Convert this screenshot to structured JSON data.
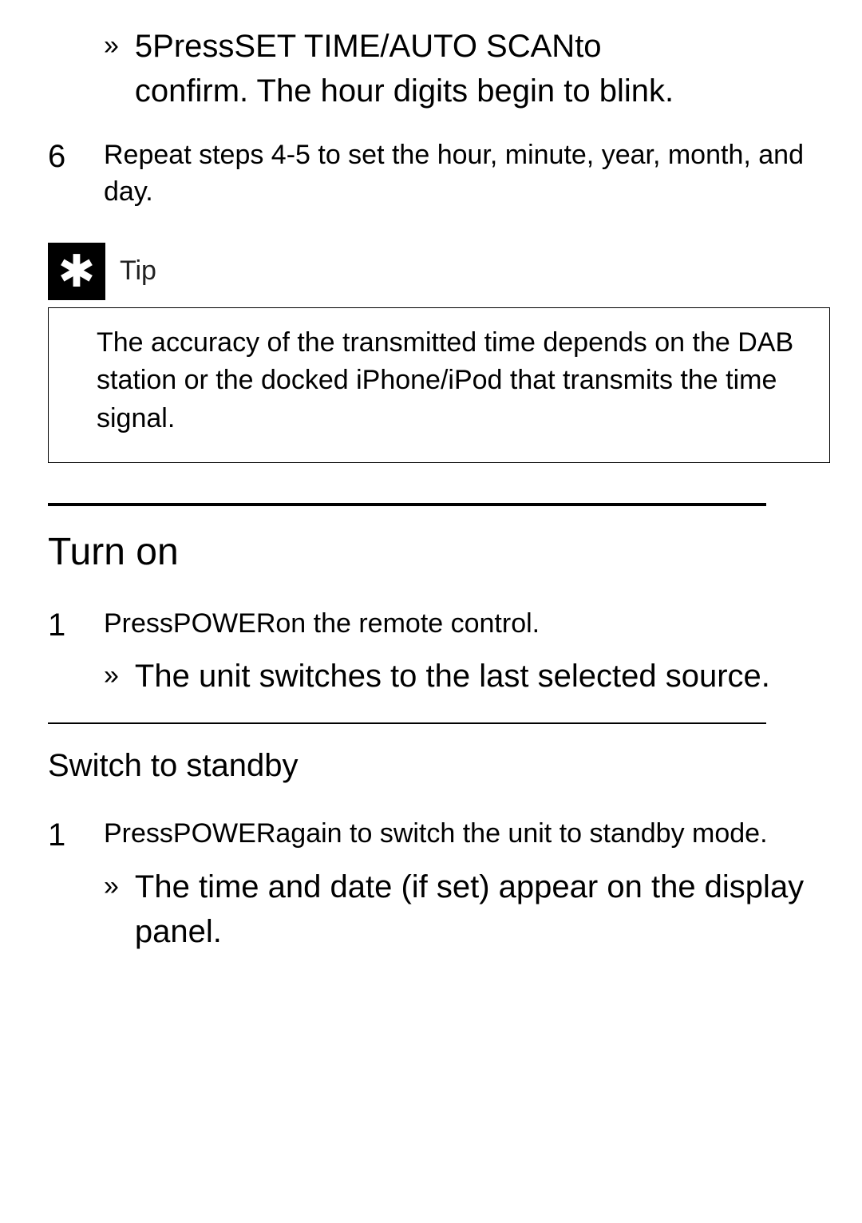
{
  "top_sub": {
    "arrow": "»",
    "line1_a": "5Press",
    "line1_b": "SET TIME/AUTO SCAN",
    "line1_c": "to",
    "line2": "conﬁrm. The hour digits begin to blink."
  },
  "step6": {
    "num": "6",
    "text": "Repeat steps 4-5 to set the hour, minute, year, month, and day."
  },
  "tip": {
    "label": "Tip",
    "body": "The accuracy of the transmitted time depends on the DAB station or the docked iPhone/iPod that transmits the time signal."
  },
  "turn_on": {
    "heading": "Turn on",
    "step1_num": "1",
    "step1_a": "Press",
    "step1_b": "POWER",
    "step1_c": "on the remote control.",
    "sub_arrow": "»",
    "sub_text": "The unit switches to the last selected source."
  },
  "standby": {
    "heading": "Switch to standby",
    "step1_num": "1",
    "step1_a": "Press",
    "step1_b": "POWER",
    "step1_c": "again to switch the unit to standby mode.",
    "sub_arrow": "»",
    "sub_text": "The time and date (if set) appear on the display panel."
  }
}
